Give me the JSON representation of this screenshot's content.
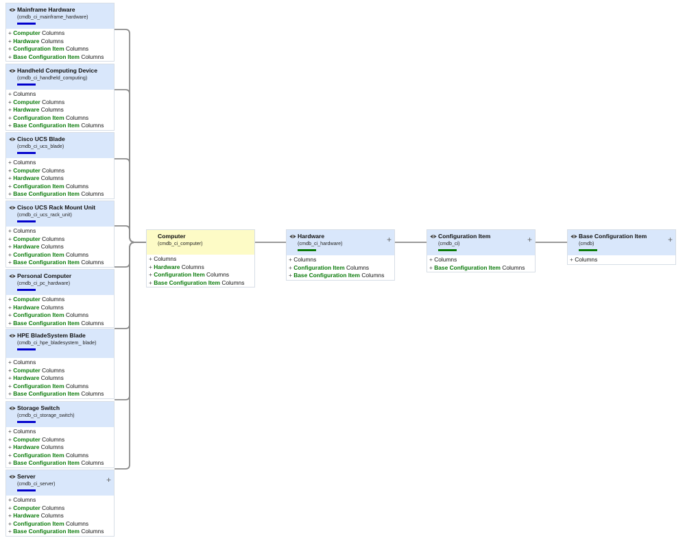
{
  "colors": {
    "connector": "#8a8a8a",
    "header_blue": "#d9e7fb",
    "header_yellow": "#fdfbc6",
    "accent_blue": "#0000cc",
    "accent_green": "#0a7a0a"
  },
  "cards": [
    {
      "id": "mainframe",
      "title": "Mainframe Hardware",
      "table": "(cmdb_ci_mainframe_hardware)",
      "eye": true,
      "plus": false,
      "bar": "blue",
      "rows": [
        {
          "class": "Computer",
          "label": "Columns"
        },
        {
          "class": "Hardware",
          "label": "Columns"
        },
        {
          "class": "Configuration Item",
          "label": "Columns"
        },
        {
          "class": "Base Configuration Item",
          "label": "Columns"
        }
      ]
    },
    {
      "id": "handheld",
      "title": "Handheld Computing Device",
      "table": "(cmdb_ci_handheld_computing)",
      "eye": true,
      "plus": false,
      "bar": "blue",
      "rows": [
        {
          "class": "",
          "label": "Columns"
        },
        {
          "class": "Computer",
          "label": "Columns"
        },
        {
          "class": "Hardware",
          "label": "Columns"
        },
        {
          "class": "Configuration Item",
          "label": "Columns"
        },
        {
          "class": "Base Configuration Item",
          "label": "Columns"
        }
      ]
    },
    {
      "id": "ucs-blade",
      "title": "Cisco UCS Blade",
      "table": "(cmdb_ci_ucs_blade)",
      "eye": true,
      "plus": false,
      "bar": "blue",
      "rows": [
        {
          "class": "",
          "label": "Columns"
        },
        {
          "class": "Computer",
          "label": "Columns"
        },
        {
          "class": "Hardware",
          "label": "Columns"
        },
        {
          "class": "Configuration Item",
          "label": "Columns"
        },
        {
          "class": "Base Configuration Item",
          "label": "Columns"
        }
      ]
    },
    {
      "id": "ucs-rack",
      "title": "Cisco UCS Rack Mount Unit",
      "table": "(cmdb_ci_ucs_rack_unit)",
      "eye": true,
      "plus": false,
      "bar": "blue",
      "rows": [
        {
          "class": "",
          "label": "Columns"
        },
        {
          "class": "Computer",
          "label": "Columns"
        },
        {
          "class": "Hardware",
          "label": "Columns"
        },
        {
          "class": "Configuration Item",
          "label": "Columns"
        },
        {
          "class": "Base Configuration Item",
          "label": "Columns"
        }
      ]
    },
    {
      "id": "pc",
      "title": "Personal Computer",
      "table": "(cmdb_ci_pc_hardware)",
      "eye": true,
      "plus": false,
      "bar": "blue",
      "rows": [
        {
          "class": "Computer",
          "label": "Columns"
        },
        {
          "class": "Hardware",
          "label": "Columns"
        },
        {
          "class": "Configuration Item",
          "label": "Columns"
        },
        {
          "class": "Base Configuration Item",
          "label": "Columns"
        }
      ]
    },
    {
      "id": "hpe-blade",
      "title": "HPE BladeSystem Blade",
      "table": "(cmdb_ci_hpe_bladesystem_ blade)",
      "eye": true,
      "plus": false,
      "bar": "blue",
      "rows": [
        {
          "class": "",
          "label": "Columns"
        },
        {
          "class": "Computer",
          "label": "Columns"
        },
        {
          "class": "Hardware",
          "label": "Columns"
        },
        {
          "class": "Configuration Item",
          "label": "Columns"
        },
        {
          "class": "Base Configuration Item",
          "label": "Columns"
        }
      ]
    },
    {
      "id": "storage",
      "title": "Storage Switch",
      "table": "(cmdb_ci_storage_switch)",
      "eye": true,
      "plus": false,
      "bar": "blue",
      "rows": [
        {
          "class": "",
          "label": "Columns"
        },
        {
          "class": "Computer",
          "label": "Columns"
        },
        {
          "class": "Hardware",
          "label": "Columns"
        },
        {
          "class": "Configuration Item",
          "label": "Columns"
        },
        {
          "class": "Base Configuration Item",
          "label": "Columns"
        }
      ]
    },
    {
      "id": "server",
      "title": "Server",
      "table": "(cmdb_ci_server)",
      "eye": true,
      "plus": true,
      "bar": "blue",
      "rows": [
        {
          "class": "",
          "label": "Columns"
        },
        {
          "class": "Computer",
          "label": "Columns"
        },
        {
          "class": "Hardware",
          "label": "Columns"
        },
        {
          "class": "Configuration Item",
          "label": "Columns"
        },
        {
          "class": "Base Configuration Item",
          "label": "Columns"
        }
      ]
    },
    {
      "id": "computer",
      "title": "Computer",
      "table": "(cmdb_ci_computer)",
      "eye": false,
      "plus": false,
      "bar": "",
      "rows": [
        {
          "class": "",
          "label": "Columns"
        },
        {
          "class": "Hardware",
          "label": "Columns"
        },
        {
          "class": "Configuration Item",
          "label": "Columns"
        },
        {
          "class": "Base Configuration Item",
          "label": "Columns"
        }
      ]
    },
    {
      "id": "hardware",
      "title": "Hardware",
      "table": "(cmdb_ci_hardware)",
      "eye": true,
      "plus": true,
      "bar": "green",
      "rows": [
        {
          "class": "",
          "label": "Columns"
        },
        {
          "class": "Configuration Item",
          "label": "Columns"
        },
        {
          "class": "Base Configuration Item",
          "label": "Columns"
        }
      ]
    },
    {
      "id": "config-item",
      "title": "Configuration Item",
      "table": "(cmdb_ci)",
      "eye": true,
      "plus": true,
      "bar": "green",
      "rows": [
        {
          "class": "",
          "label": "Columns"
        },
        {
          "class": "Base Configuration Item",
          "label": "Columns"
        }
      ]
    },
    {
      "id": "base-config-item",
      "title": "Base Configuration Item",
      "table": "(cmdb)",
      "eye": true,
      "plus": true,
      "bar": "green",
      "rows": [
        {
          "class": "",
          "label": "Columns"
        }
      ]
    }
  ],
  "edges": [
    [
      "mainframe",
      "computer"
    ],
    [
      "handheld",
      "computer"
    ],
    [
      "ucs-blade",
      "computer"
    ],
    [
      "ucs-rack",
      "computer"
    ],
    [
      "pc",
      "computer"
    ],
    [
      "hpe-blade",
      "computer"
    ],
    [
      "storage",
      "computer"
    ],
    [
      "server",
      "computer"
    ],
    [
      "computer",
      "hardware"
    ],
    [
      "hardware",
      "config-item"
    ],
    [
      "config-item",
      "base-config-item"
    ]
  ]
}
